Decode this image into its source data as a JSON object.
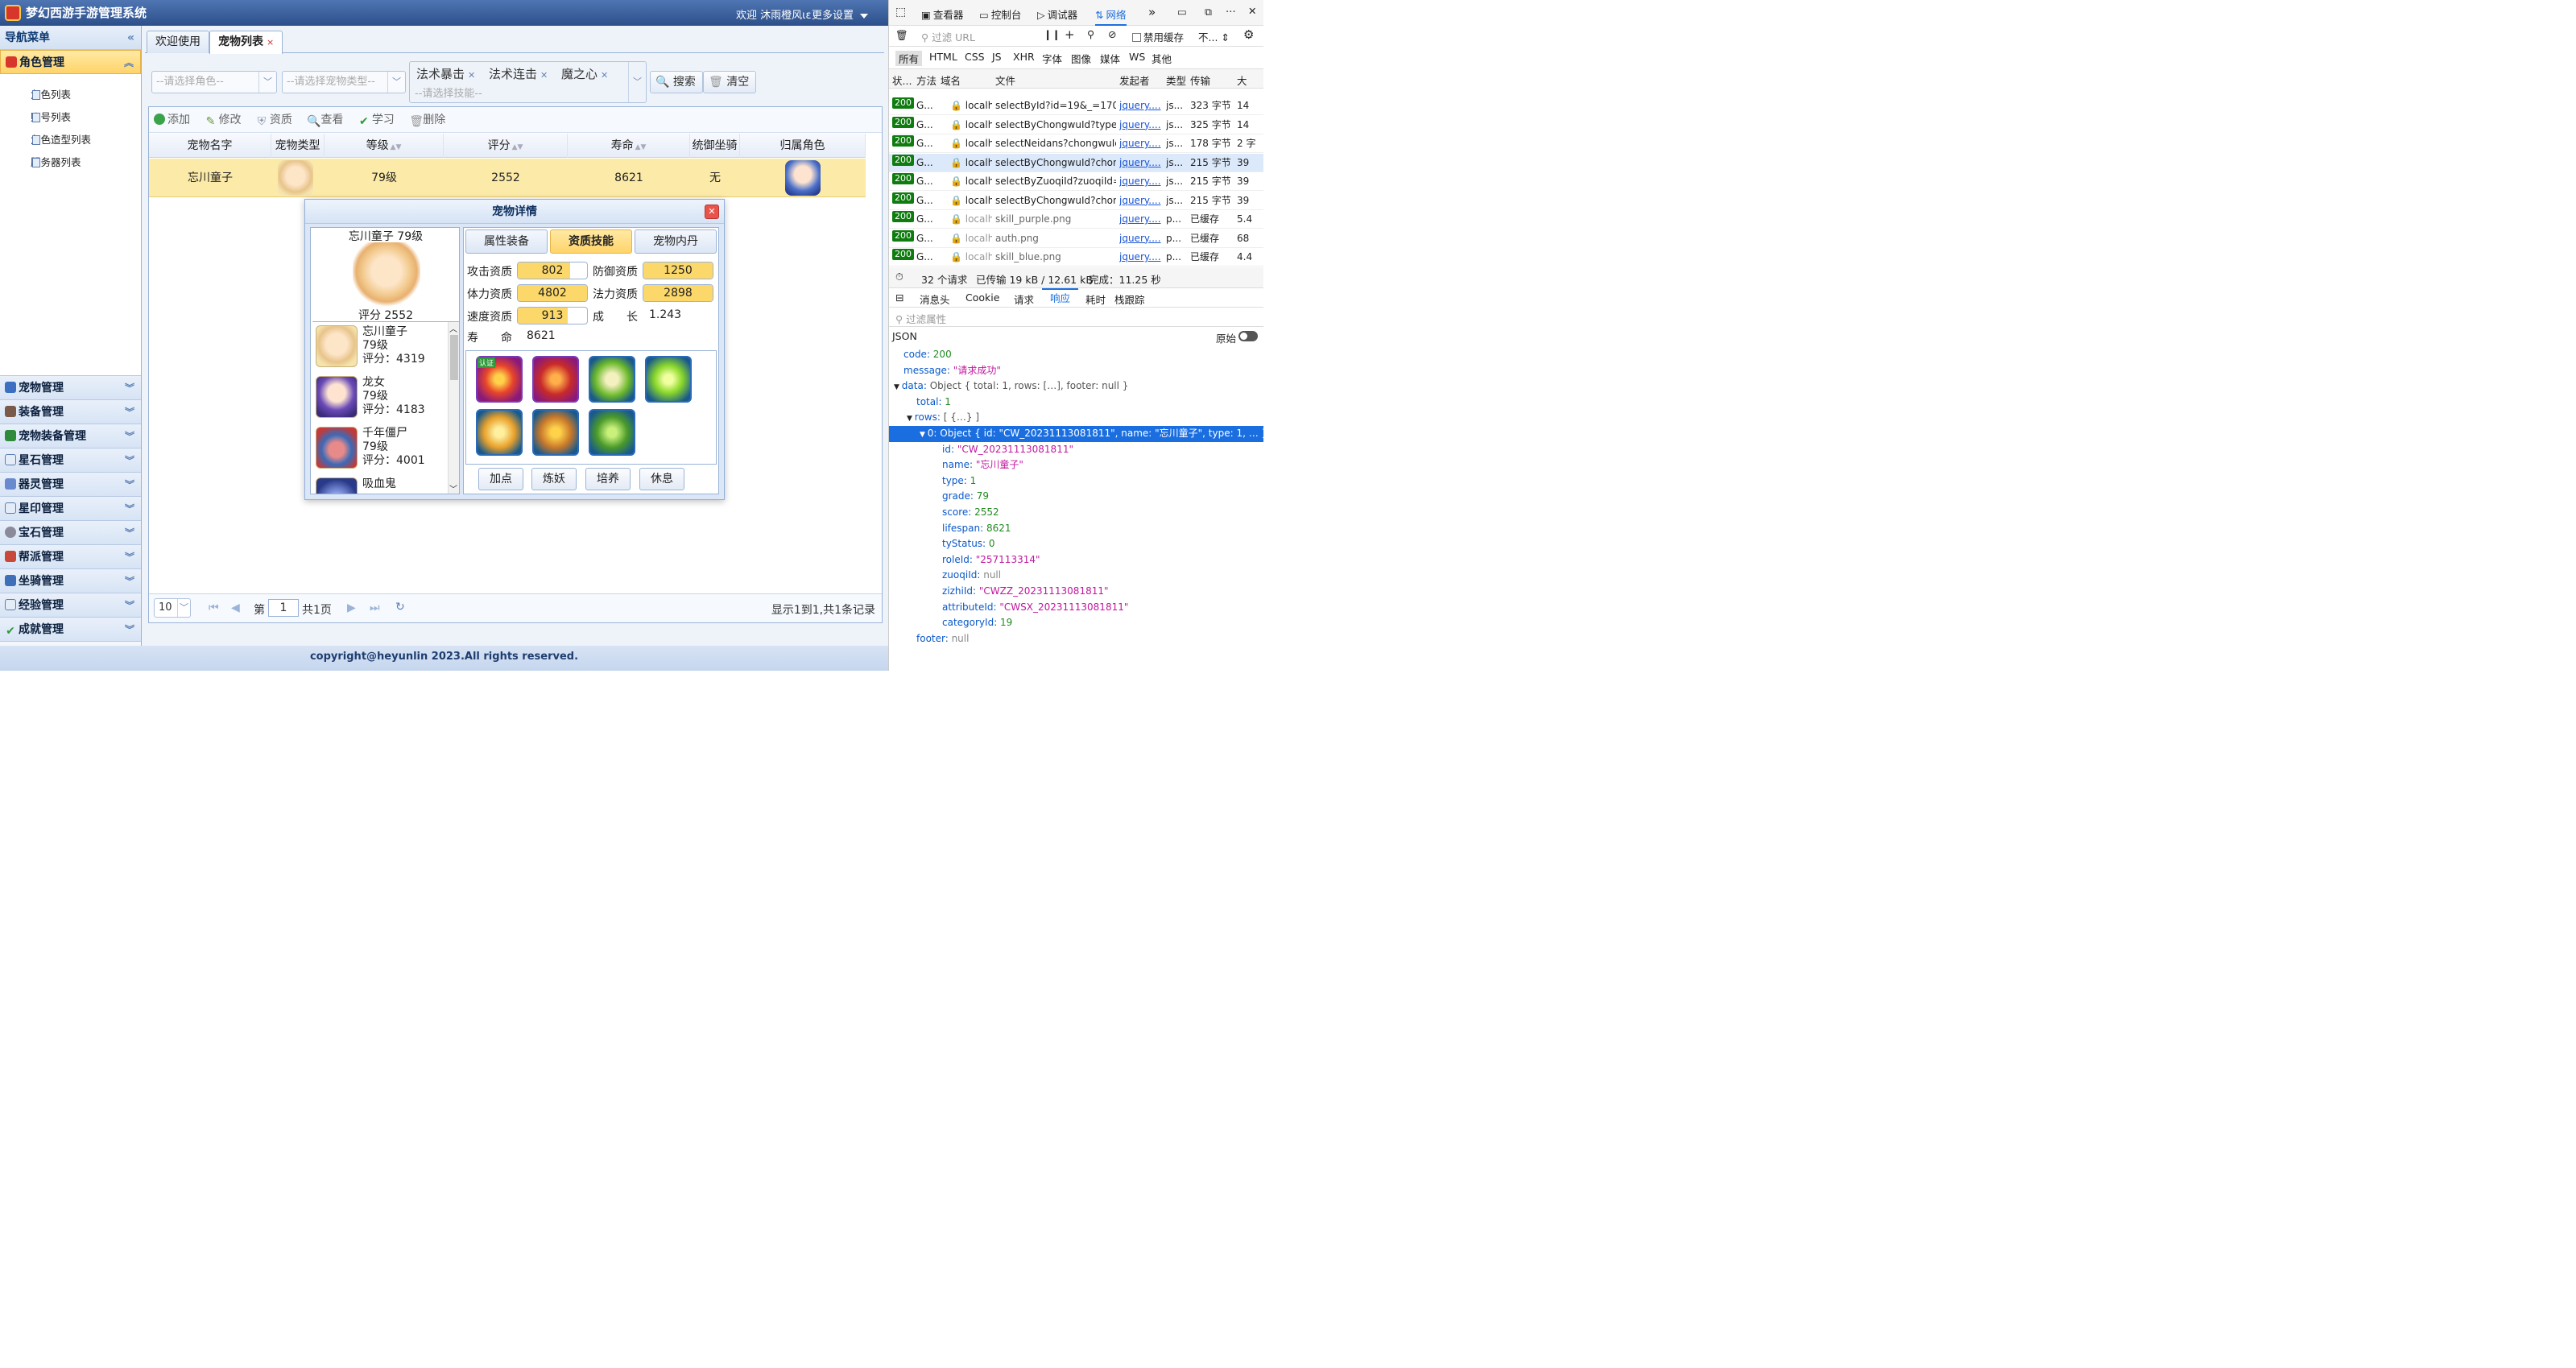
{
  "app": {
    "title": "梦幻西游手游管理系统",
    "welcome": "欢迎 沐雨橙风ιε",
    "more_settings": "更多设置",
    "footer": "copyright@heyunlin 2023.All rights reserved."
  },
  "sidebar": {
    "header": "导航菜单",
    "collapse_icon": "«",
    "active_group": "角色管理",
    "sub_items": [
      "角色列表",
      "账号列表",
      "角色造型列表",
      "服务器列表"
    ],
    "groups": [
      "宠物管理",
      "装备管理",
      "宠物装备管理",
      "星石管理",
      "器灵管理",
      "星印管理",
      "宝石管理",
      "帮派管理",
      "坐骑管理",
      "经验管理",
      "成就管理"
    ]
  },
  "tabs": [
    {
      "label": "欢迎使用"
    },
    {
      "label": "宠物列表",
      "closable": "×"
    }
  ],
  "filters": {
    "role_placeholder": "--请选择角色--",
    "type_placeholder": "--请选择宠物类型--",
    "skill_chips": [
      "法术暴击",
      "法术连击",
      "魔之心"
    ],
    "skill_placeholder": "--请选择技能--",
    "search": "搜索",
    "clear": "清空"
  },
  "toolbar": [
    "添加",
    "修改",
    "资质",
    "查看",
    "学习",
    "删除"
  ],
  "table": {
    "columns": [
      "宠物名字",
      "宠物类型",
      "等级",
      "评分",
      "寿命",
      "统御坐骑",
      "归属角色"
    ],
    "rows": [
      {
        "name": "忘川童子",
        "level": "79级",
        "score": "2552",
        "lifespan": "8621",
        "mount": "无"
      }
    ]
  },
  "pager": {
    "page_size": "10",
    "page_prefix": "第",
    "page": "1",
    "page_suffix": "共1页",
    "summary": "显示1到1,共1条记录"
  },
  "dialog": {
    "title": "宠物详情",
    "pet_title": "忘川童子   79级",
    "pet_score": "评分   2552",
    "list": [
      {
        "name": "忘川童子",
        "level": "79级",
        "score": "评分：4319"
      },
      {
        "name": "龙女",
        "level": "79级",
        "score": "评分：4183"
      },
      {
        "name": "千年僵尸",
        "level": "79级",
        "score": "评分：4001"
      },
      {
        "name": "吸血鬼",
        "level": "",
        "score": ""
      }
    ],
    "tabs": [
      "属性装备",
      "资质技能",
      "宠物内丹"
    ],
    "attrs": {
      "attack_label": "攻击资质",
      "attack": "802",
      "attack_fill": 0.76,
      "defense_label": "防御资质",
      "defense": "1250",
      "defense_fill": 1.0,
      "hp_label": "体力资质",
      "hp": "4802",
      "hp_fill": 1.0,
      "magic_label": "法力资质",
      "magic": "2898",
      "magic_fill": 1.0,
      "speed_label": "速度资质",
      "speed": "913",
      "speed_fill": 0.72,
      "growth_label": "成　　长",
      "growth": "1.243",
      "life_label": "寿　　命",
      "life": "8621"
    },
    "skill_badge": "认证",
    "actions": [
      "加点",
      "炼妖",
      "培养",
      "休息"
    ]
  },
  "devtools": {
    "tabs": [
      "查看器",
      "控制台",
      "调试器",
      "网络"
    ],
    "filter_placeholder": "过滤 URL",
    "disable_cache": "禁用缓存",
    "throttle": "不...",
    "types": [
      "所有",
      "HTML",
      "CSS",
      "JS",
      "XHR",
      "字体",
      "图像",
      "媒体",
      "WS",
      "其他"
    ],
    "columns": [
      "状...",
      "方法",
      "域名",
      "文件",
      "发起者",
      "类型",
      "传输",
      "大"
    ],
    "requests": [
      {
        "status": "200",
        "method": "G...",
        "domain": "localh...",
        "file": "selectById?id=19&_=170010",
        "initiator": "jquery....",
        "type": "js...",
        "transfer": "323 字节",
        "size": "14"
      },
      {
        "status": "200",
        "method": "G...",
        "domain": "localh...",
        "file": "selectByChongwuId?type=1&",
        "initiator": "jquery....",
        "type": "js...",
        "transfer": "325 字节",
        "size": "14"
      },
      {
        "status": "200",
        "method": "G...",
        "domain": "localh...",
        "file": "selectNeidans?chongwuId=C",
        "initiator": "jquery....",
        "type": "js...",
        "transfer": "178 字节",
        "size": "2 字"
      },
      {
        "status": "200",
        "method": "G...",
        "domain": "localh...",
        "file": "selectByChongwuId?chongw",
        "initiator": "jquery....",
        "type": "js...",
        "transfer": "215 字节",
        "size": "39"
      },
      {
        "status": "200",
        "method": "G...",
        "domain": "localh...",
        "file": "selectByZuoqiId?zuoqiId=&_",
        "initiator": "jquery....",
        "type": "js...",
        "transfer": "215 字节",
        "size": "39"
      },
      {
        "status": "200",
        "method": "G...",
        "domain": "localh...",
        "file": "selectByChongwuId?chongw",
        "initiator": "jquery....",
        "type": "js...",
        "transfer": "215 字节",
        "size": "39"
      },
      {
        "status": "200",
        "method": "G...",
        "domain": "localh...",
        "file": "skill_purple.png",
        "initiator": "jquery....",
        "type": "p...",
        "transfer": "已缓存",
        "size": "5.4"
      },
      {
        "status": "200",
        "method": "G...",
        "domain": "localh...",
        "file": "auth.png",
        "initiator": "jquery....",
        "type": "p...",
        "transfer": "已缓存",
        "size": "68"
      },
      {
        "status": "200",
        "method": "G...",
        "domain": "localh...",
        "file": "skill_blue.png",
        "initiator": "jquery....",
        "type": "p...",
        "transfer": "已缓存",
        "size": "4.4"
      }
    ],
    "summary": {
      "count": "32 个请求",
      "transferred": "已传输 19 kB / 12.61 kB",
      "finish": "完成：11.25 秒"
    },
    "detail_tabs": [
      "消息头",
      "Cookie",
      "请求",
      "响应",
      "耗时",
      "栈跟踪"
    ],
    "filter_props": "过滤属性",
    "json_label": "JSON",
    "raw_label": "原始",
    "json_lines": [
      {
        "key": "code",
        "val": "200",
        "kind": "n"
      },
      {
        "key": "message",
        "val": "\"请求成功\"",
        "kind": "s"
      },
      {
        "key": "data",
        "val": "Object { total: 1, rows: […], footer: null }",
        "kind": "o"
      },
      {
        "key": "total",
        "val": "1",
        "kind": "n"
      },
      {
        "key": "rows",
        "val": "[ {…} ]",
        "kind": "o"
      },
      {
        "key": "0",
        "val": "Object { id: \"CW_20231113081811\", name: \"忘川童子\", type: 1, … }",
        "kind": "sel"
      },
      {
        "key": "id",
        "val": "\"CW_20231113081811\"",
        "kind": "s"
      },
      {
        "key": "name",
        "val": "\"忘川童子\"",
        "kind": "s"
      },
      {
        "key": "type",
        "val": "1",
        "kind": "n"
      },
      {
        "key": "grade",
        "val": "79",
        "kind": "n"
      },
      {
        "key": "score",
        "val": "2552",
        "kind": "n"
      },
      {
        "key": "lifespan",
        "val": "8621",
        "kind": "n"
      },
      {
        "key": "tyStatus",
        "val": "0",
        "kind": "n"
      },
      {
        "key": "roleId",
        "val": "\"257113314\"",
        "kind": "s"
      },
      {
        "key": "zuoqiId",
        "val": "null",
        "kind": "nl"
      },
      {
        "key": "zizhiId",
        "val": "\"CWZZ_20231113081811\"",
        "kind": "s"
      },
      {
        "key": "attributeId",
        "val": "\"CWSX_20231113081811\"",
        "kind": "s"
      },
      {
        "key": "categoryId",
        "val": "19",
        "kind": "n"
      },
      {
        "key": "footer",
        "val": "null",
        "kind": "nl"
      }
    ]
  }
}
